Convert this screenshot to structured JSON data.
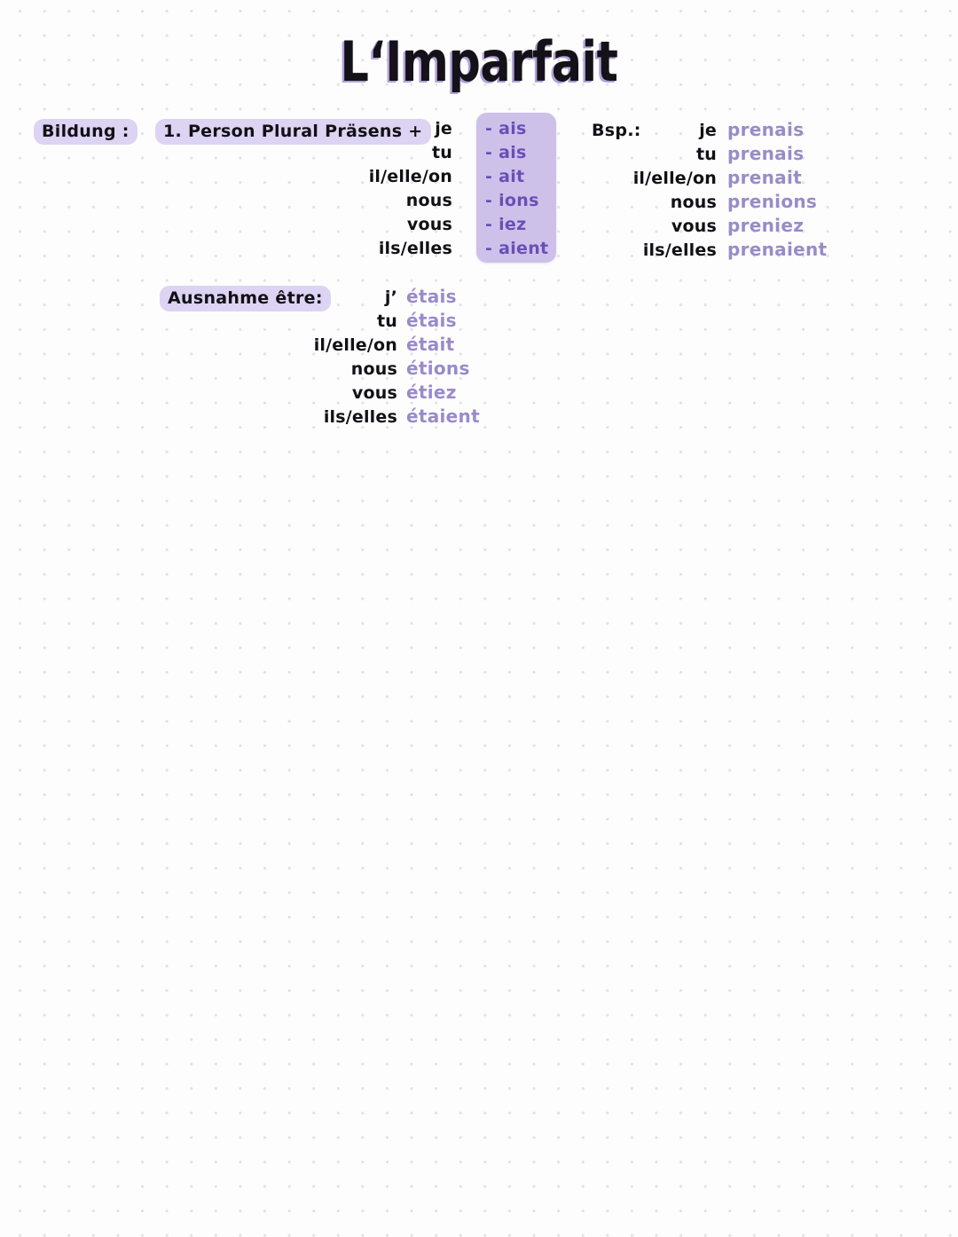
{
  "page": {
    "title": "L‘Imparfait",
    "paper_color": "#fdfdfd",
    "dot_color": "#e2e2e6",
    "highlight_color": "#ddd3f2",
    "box_fill_color": "#cdc1ea",
    "box_text_color": "#6a4fb6",
    "verb_text_color": "#9a8bc8",
    "ink_color": "#121016"
  },
  "section_bildung": {
    "label": "Bildung :",
    "rule": "1. Person Plural Präsens +",
    "pronouns": [
      "je",
      "tu",
      "il/elle/on",
      "nous",
      "vous",
      "ils/elles"
    ],
    "endings": [
      "- ais",
      "- ais",
      "- ait",
      "- ions",
      "- iez",
      "- aient"
    ],
    "example_label": "Bsp.:",
    "example": [
      {
        "pronoun": "je",
        "form": "prenais"
      },
      {
        "pronoun": "tu",
        "form": "prenais"
      },
      {
        "pronoun": "il/elle/on",
        "form": "prenait"
      },
      {
        "pronoun": "nous",
        "form": "prenions"
      },
      {
        "pronoun": "vous",
        "form": "preniez"
      },
      {
        "pronoun": "ils/elles",
        "form": "prenaient"
      }
    ]
  },
  "section_exception": {
    "label": "Ausnahme être:",
    "rows": [
      {
        "pronoun": "j’",
        "form": "étais"
      },
      {
        "pronoun": "tu",
        "form": "étais"
      },
      {
        "pronoun": "il/elle/on",
        "form": "était"
      },
      {
        "pronoun": "nous",
        "form": "étions"
      },
      {
        "pronoun": "vous",
        "form": "étiez"
      },
      {
        "pronoun": "ils/elles",
        "form": "étaient"
      }
    ]
  }
}
